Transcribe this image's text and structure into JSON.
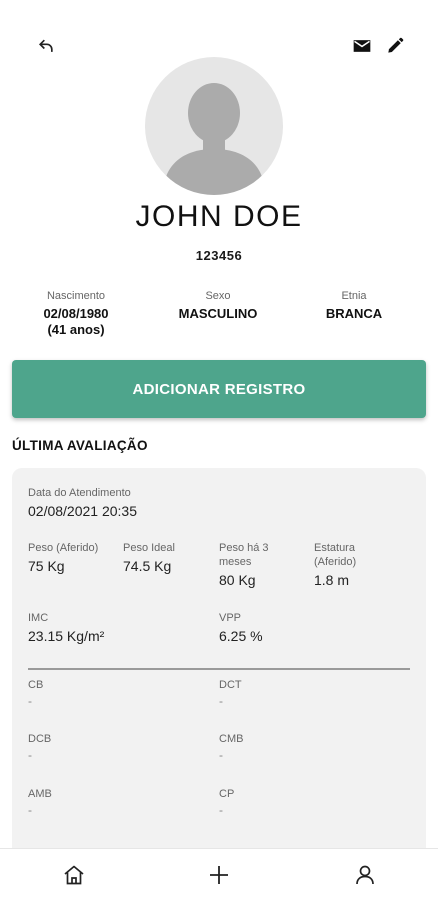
{
  "header": {
    "back_icon": "arrow-back-icon",
    "mail_icon": "mail-icon",
    "edit_icon": "pencil-icon"
  },
  "patient": {
    "name": "JOHN DOE",
    "id": "123456",
    "birth_label": "Nascimento",
    "birth_date": "02/08/1980",
    "age": "(41 anos)",
    "sex_label": "Sexo",
    "sex": "MASCULINO",
    "ethnicity_label": "Etnia",
    "ethnicity": "BRANCA"
  },
  "actions": {
    "add_record": "ADICIONAR REGISTRO"
  },
  "last_evaluation": {
    "title": "ÚLTIMA AVALIAÇÃO",
    "date_label": "Data do Atendimento",
    "date_value": "02/08/2021 20:35",
    "weight_label": "Peso (Aferido)",
    "weight_value": "75 Kg",
    "ideal_weight_label": "Peso Ideal",
    "ideal_weight_value": "74.5 Kg",
    "weight_3m_label": "Peso há 3 meses",
    "weight_3m_value": "80 Kg",
    "height_label": "Estatura (Aferido)",
    "height_value": "1.8 m",
    "bmi_label": "IMC",
    "bmi_value": "23.15 Kg/m²",
    "vpp_label": "VPP",
    "vpp_value": "6.25 %",
    "cb_label": "CB",
    "cb_value": "-",
    "dct_label": "DCT",
    "dct_value": "-",
    "dcb_label": "DCB",
    "dcb_value": "-",
    "cmb_label": "CMB",
    "cmb_value": "-",
    "amb_label": "AMB",
    "amb_value": "-",
    "cp_label": "CP",
    "cp_value": "-"
  },
  "nav": {
    "home_icon": "home-icon",
    "add_icon": "plus-icon",
    "profile_icon": "user-icon"
  },
  "colors": {
    "accent": "#4ea58c",
    "card_bg": "#f2f2f2"
  }
}
